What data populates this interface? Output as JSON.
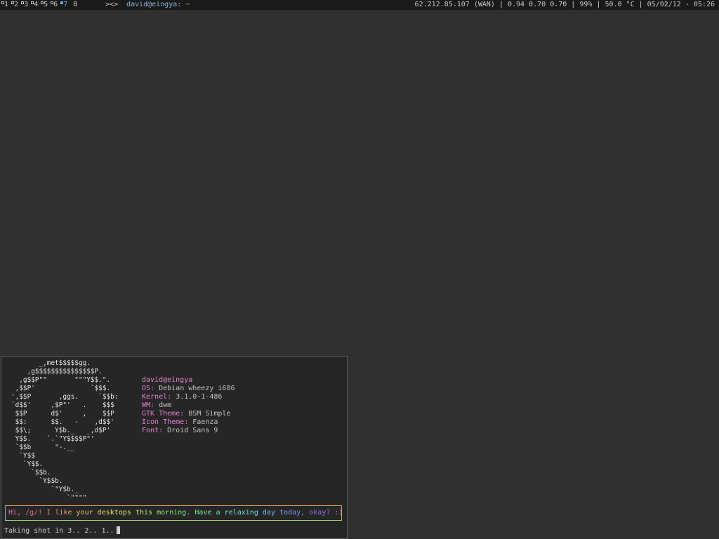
{
  "bar": {
    "tags": [
      {
        "label": "1",
        "occupied": true,
        "selected": false
      },
      {
        "label": "2",
        "occupied": true,
        "selected": false
      },
      {
        "label": "3",
        "occupied": true,
        "selected": false
      },
      {
        "label": "4",
        "occupied": true,
        "selected": false
      },
      {
        "label": "5",
        "occupied": true,
        "selected": false
      },
      {
        "label": "6",
        "occupied": true,
        "selected": false
      },
      {
        "label": "7",
        "occupied": true,
        "selected": true
      },
      {
        "label": "8",
        "occupied": false,
        "selected": false
      }
    ],
    "layout_symbol": "><>",
    "window_title": "david@eingya: ~",
    "status": "62.212.85.107 (WAN) | 0.94 0.70 0.70 | 99% | 50.0 °C | 05/02/12 - 05:26",
    "colors": {
      "bar_bg": "#1a1a1a",
      "selected": "#6fa8dc"
    }
  },
  "terminal": {
    "logo_lines": [
      "       _,met$$$$$gg.",
      "    ,g$$$$$$$$$$$$$$$P.",
      "  ,g$$P\"\"       \"\"\"Y$$.\".",
      " ,$$P'              `$$$.",
      "',$$P       ,ggs.     `$$b:",
      "`d$$'     ,$P\"'   .    $$$",
      " $$P      d$'     ,    $$P",
      " $$:      $$.   -    ,d$$'",
      " $$\\;      Y$b._   _,d$P'",
      " Y$$.    `.`\"Y$$$$P\"'",
      " `$$b      \"-.__",
      "  `Y$$",
      "   `Y$$.",
      "     `$$b.",
      "       `Y$$b.",
      "          `\"Y$b._",
      "              `\"\"\"\""
    ],
    "user_host": "david@eingya",
    "info": [
      {
        "key": "OS:",
        "value": "Debian wheezy i686"
      },
      {
        "key": "Kernel:",
        "value": "3.1.0-1-486"
      },
      {
        "key": "WM:",
        "value": "dwm"
      },
      {
        "key": "GTK Theme:",
        "value": "BSM Simple"
      },
      {
        "key": "Icon Theme:",
        "value": "Faenza"
      },
      {
        "key": "Font:",
        "value": "Droid Sans 9"
      }
    ],
    "greeting": "Hi, /g/! I like your desktops this morning. Have a relaxing day today, okay? :)",
    "prompt": "Taking shot in 3.. 2.. 1..",
    "colors": {
      "label": "#e37fd0",
      "logo_accent": "#e0507a"
    }
  }
}
